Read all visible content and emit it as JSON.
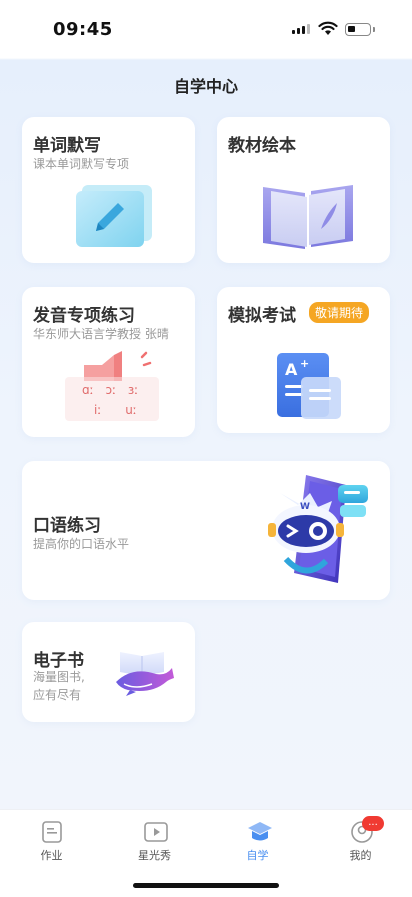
{
  "status_bar": {
    "time": "09:45"
  },
  "header": {
    "title": "自学中心"
  },
  "cards": {
    "dictation": {
      "title": "单词默写",
      "subtitle": "课本单词默写专项"
    },
    "textbook": {
      "title": "教材绘本"
    },
    "pronunciation": {
      "title": "发音专项练习",
      "subtitle": "华东师大语言学教授 张晴",
      "phonetics_row1": "ɑː ɔː ɜː",
      "phonetics_row2": "iː uː"
    },
    "mock_exam": {
      "title": "模拟考试",
      "badge": "敬请期待"
    },
    "oral": {
      "title": "口语练习",
      "subtitle": "提高你的口语水平"
    },
    "ebook": {
      "title": "电子书",
      "subtitle_line1": "海量图书,",
      "subtitle_line2": "应有尽有"
    }
  },
  "tabbar": {
    "items": [
      {
        "label": "作业",
        "icon": "homework-icon"
      },
      {
        "label": "星光秀",
        "icon": "play-video-icon"
      },
      {
        "label": "自学",
        "icon": "graduation-cap-icon",
        "active": true
      },
      {
        "label": "我的",
        "icon": "profile-icon",
        "badge": "..."
      }
    ]
  },
  "colors": {
    "accent": "#4a8ff0",
    "badge": "#f5a623",
    "notify": "#f03a32"
  }
}
